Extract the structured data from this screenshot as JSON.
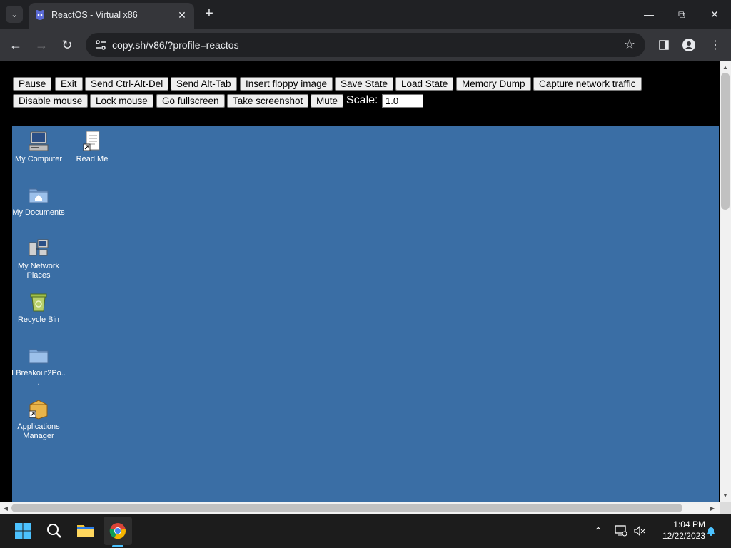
{
  "browser": {
    "tab_title": "ReactOS - Virtual x86",
    "url": "copy.sh/v86/?profile=reactos"
  },
  "v86_controls": {
    "row1": [
      "Pause",
      "Exit",
      "Send Ctrl-Alt-Del",
      "Send Alt-Tab",
      "Insert floppy image",
      "Save State",
      "Load State",
      "Memory Dump",
      "Capture network traffic"
    ],
    "row2": [
      "Disable mouse",
      "Lock mouse",
      "Go fullscreen",
      "Take screenshot",
      "Mute"
    ],
    "scale_label": "Scale:",
    "scale_value": "1.0"
  },
  "desktop": {
    "background": "#3a6ea5",
    "icons": [
      {
        "label": "My Computer",
        "icon": "computer-icon"
      },
      {
        "label": "Read Me",
        "icon": "document-shortcut-icon"
      },
      {
        "label": "My Documents",
        "icon": "documents-folder-icon"
      },
      {
        "label": "My Network Places",
        "icon": "network-icon"
      },
      {
        "label": "Recycle Bin",
        "icon": "recycle-bin-icon"
      },
      {
        "label": "LBreakout2Po...",
        "icon": "folder-icon"
      },
      {
        "label": "Applications Manager",
        "icon": "package-shortcut-icon"
      }
    ]
  },
  "taskbar": {
    "time": "1:04 PM",
    "date": "12/22/2023",
    "apps": [
      "start-icon",
      "search-icon",
      "file-explorer-icon",
      "chrome-icon"
    ]
  }
}
